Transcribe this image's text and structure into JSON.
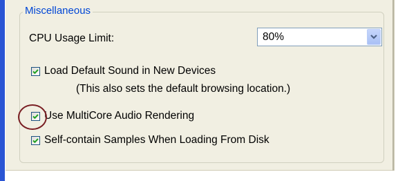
{
  "group": {
    "title": "Miscellaneous"
  },
  "cpu_limit": {
    "label": "CPU Usage Limit:",
    "selected_value": "80%"
  },
  "options": [
    {
      "label": "Load Default Sound in New Devices",
      "checked": true,
      "note": "(This also sets the default browsing location.)"
    },
    {
      "label": "Use MultiCore Audio Rendering",
      "checked": true,
      "highlighted": true
    },
    {
      "label": "Self-contain Samples When Loading From Disk",
      "checked": true
    }
  ],
  "colors": {
    "accent": "#2a55d4",
    "panel": "#f1efe2",
    "group_title": "#0046d5",
    "check": "#21a121",
    "highlight_ring": "#7a1f24"
  }
}
